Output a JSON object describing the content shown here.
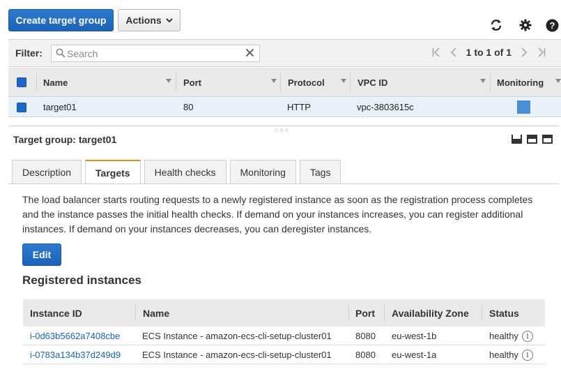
{
  "toolbar": {
    "create_label": "Create target group",
    "actions_label": "Actions",
    "icons": [
      "refresh-icon",
      "gear-icon",
      "help-icon"
    ]
  },
  "filter": {
    "label": "Filter:",
    "placeholder": "Search",
    "pagination": "1 to 1 of 1"
  },
  "target_groups": {
    "columns": [
      "Name",
      "Port",
      "Protocol",
      "VPC ID",
      "Monitoring"
    ],
    "rows": [
      {
        "name": "target01",
        "port": "80",
        "protocol": "HTTP",
        "vpc_id": "vpc-3803615c",
        "selected": true
      }
    ]
  },
  "detail": {
    "title": "Target group: target01",
    "tabs": [
      "Description",
      "Targets",
      "Health checks",
      "Monitoring",
      "Tags"
    ],
    "active_tab": "Targets",
    "description": "The load balancer starts routing requests to a newly registered instance as soon as the registration process completes and the instance passes the initial health checks. If demand on your instances increases, you can register additional instances. If demand on your instances decreases, you can deregister instances.",
    "edit_label": "Edit",
    "registered_title": "Registered instances"
  },
  "instances": {
    "columns": [
      "Instance ID",
      "Name",
      "Port",
      "Availability Zone",
      "Status"
    ],
    "rows": [
      {
        "id": "i-0d63b5662a7408cbe",
        "name": "ECS Instance - amazon-ecs-cli-setup-cluster01",
        "port": "8080",
        "az": "eu-west-1b",
        "status": "healthy"
      },
      {
        "id": "i-0783a134b37d249d9",
        "name": "ECS Instance - amazon-ecs-cli-setup-cluster01",
        "port": "8080",
        "az": "eu-west-1a",
        "status": "healthy"
      }
    ]
  },
  "colors": {
    "primary_button": "#1c62b8",
    "selected_row": "#e9f1fb",
    "active_tab_accent": "#e68a24",
    "link": "#1a64b4"
  }
}
